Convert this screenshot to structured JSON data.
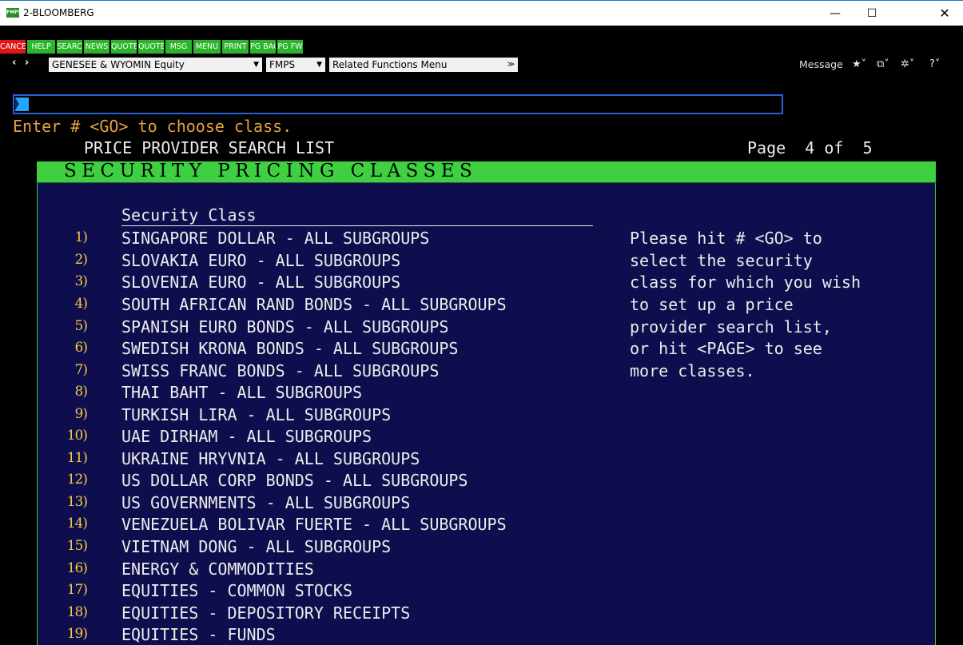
{
  "window": {
    "icon_text": "FMPS",
    "title": "2-BLOOMBERG",
    "minimize": "—",
    "maximize": "☐",
    "close": "✕"
  },
  "fkeys": [
    {
      "label": "CANCE",
      "color": "red"
    },
    {
      "label": "HELP",
      "color": "green"
    },
    {
      "label": "SEARC",
      "color": "green"
    },
    {
      "label": "NEWS",
      "color": "green"
    },
    {
      "label": "QUOTE",
      "color": "green"
    },
    {
      "label": "QUOTE",
      "color": "green"
    },
    {
      "label": "MSG",
      "color": "green"
    },
    {
      "label": "MENU",
      "color": "green"
    },
    {
      "label": "PRINT",
      "color": "green"
    },
    {
      "label": "PG BAC",
      "color": "green"
    },
    {
      "label": "PG FW",
      "color": "green"
    }
  ],
  "toolbar": {
    "nav": "‹ ›",
    "security": "GENESEE & WYOMIN Equity",
    "function": "FMPS",
    "related": "Related Functions  Menu",
    "message": "Message",
    "icons": [
      "star-icon",
      "window-icon",
      "gear-icon",
      "help-icon"
    ]
  },
  "terminal": {
    "instruction": "Enter # <GO> to choose class.",
    "screen_title": "PRICE PROVIDER SEARCH LIST",
    "page": "Page  4 of  5",
    "section_header": "SECURITY PRICING CLASSES",
    "column_header": "Security Class",
    "rows": [
      {
        "num": "1)",
        "label": "SINGAPORE DOLLAR - ALL SUBGROUPS"
      },
      {
        "num": "2)",
        "label": "SLOVAKIA EURO - ALL SUBGROUPS"
      },
      {
        "num": "3)",
        "label": "SLOVENIA EURO - ALL SUBGROUPS"
      },
      {
        "num": "4)",
        "label": "SOUTH AFRICAN RAND BONDS - ALL SUBGROUPS"
      },
      {
        "num": "5)",
        "label": "SPANISH EURO BONDS - ALL SUBGROUPS"
      },
      {
        "num": "6)",
        "label": "SWEDISH KRONA BONDS - ALL SUBGROUPS"
      },
      {
        "num": "7)",
        "label": "SWISS FRANC BONDS - ALL SUBGROUPS"
      },
      {
        "num": "8)",
        "label": "THAI BAHT - ALL SUBGROUPS"
      },
      {
        "num": "9)",
        "label": "TURKISH LIRA - ALL SUBGROUPS"
      },
      {
        "num": "10)",
        "label": "UAE DIRHAM - ALL SUBGROUPS"
      },
      {
        "num": "11)",
        "label": "UKRAINE HRYVNIA - ALL SUBGROUPS"
      },
      {
        "num": "12)",
        "label": "US DOLLAR CORP BONDS - ALL SUBGROUPS"
      },
      {
        "num": "13)",
        "label": "US GOVERNMENTS - ALL SUBGROUPS"
      },
      {
        "num": "14)",
        "label": "VENEZUELA BOLIVAR FUERTE - ALL SUBGROUPS"
      },
      {
        "num": "15)",
        "label": "VIETNAM DONG - ALL SUBGROUPS"
      },
      {
        "num": "16)",
        "label": "ENERGY & COMMODITIES"
      },
      {
        "num": "17)",
        "label": "EQUITIES - COMMON STOCKS"
      },
      {
        "num": "18)",
        "label": "EQUITIES - DEPOSITORY RECEIPTS"
      },
      {
        "num": "19)",
        "label": "EQUITIES - FUNDS"
      }
    ],
    "help_text": [
      "Please hit # <GO> to",
      "select the security",
      "class for which you wish",
      "to set up a price",
      "provider search list,",
      "or hit <PAGE> to see",
      "more classes."
    ]
  },
  "colors": {
    "fkey_green": "#2cb52c",
    "fkey_red": "#e01818",
    "instruction": "#e6a23c",
    "section_header_bg": "#3ed040",
    "panel_bg": "#0e0e4e",
    "row_number": "#f5c842",
    "cursor": "#24a6ff"
  }
}
